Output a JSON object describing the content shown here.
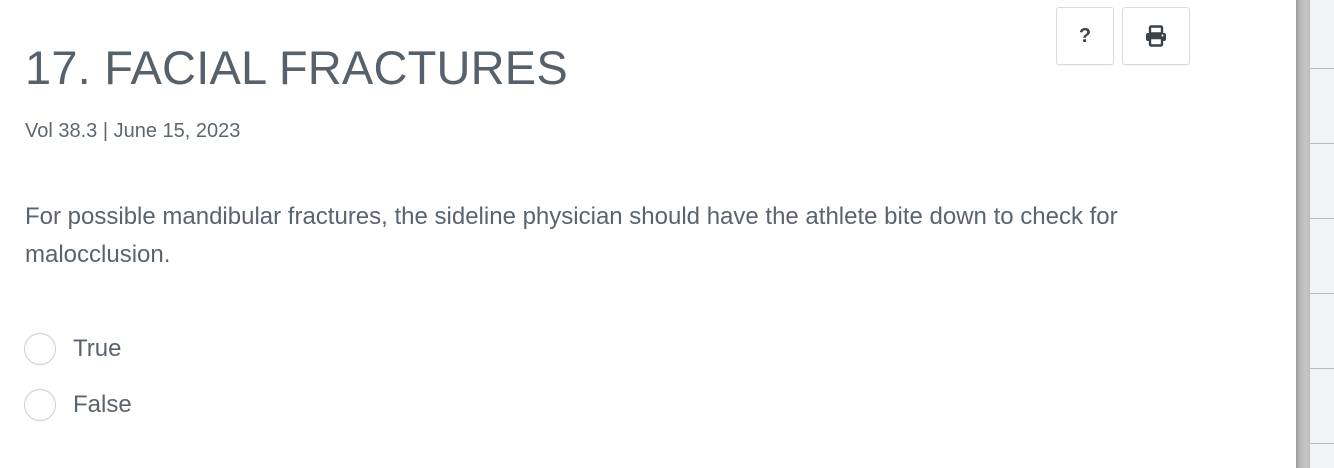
{
  "article": {
    "title": "17. FACIAL FRACTURES",
    "meta": "Vol 38.3 | June 15, 2023"
  },
  "toolbar": {
    "help_label": "?",
    "help_icon": "help-icon",
    "print_icon": "printer-icon"
  },
  "quiz": {
    "question": "For possible mandibular fractures, the sideline physician should have the athlete bite down to check for malocclusion.",
    "options": [
      {
        "label": "True",
        "selected": false
      },
      {
        "label": "False",
        "selected": false
      }
    ]
  },
  "colors": {
    "text": "#5a6470",
    "radio_border": "#c9ced3",
    "button_border": "#d7dbdf"
  }
}
